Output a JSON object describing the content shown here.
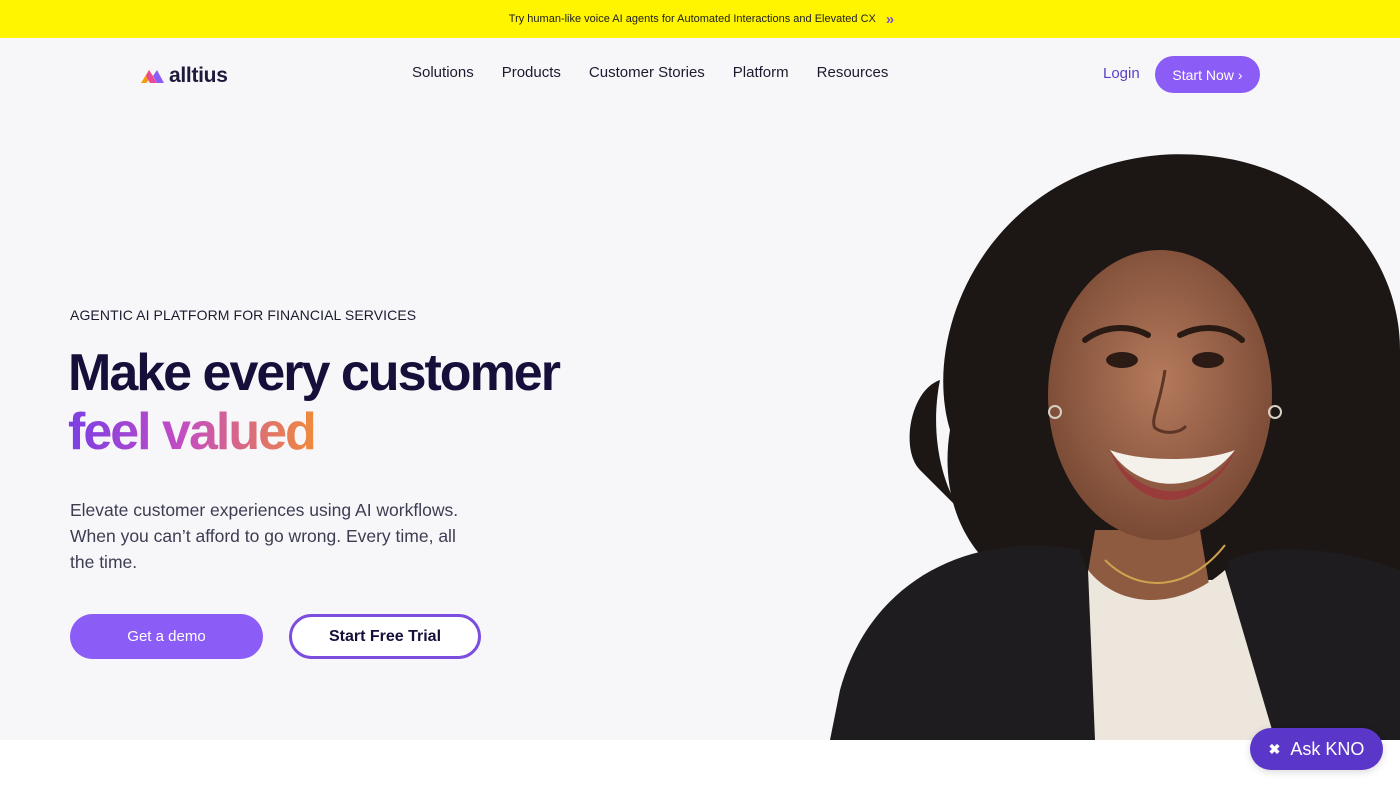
{
  "announcement": {
    "text": "Try human-like voice AI agents for Automated Interactions and Elevated CX",
    "icon": "double-chevron-right-icon",
    "chevron": "»"
  },
  "nav": {
    "logo_text": "alltius",
    "menu": [
      {
        "label": "Solutions"
      },
      {
        "label": "Products"
      },
      {
        "label": "Customer Stories"
      },
      {
        "label": "Platform"
      },
      {
        "label": "Resources"
      }
    ],
    "login": "Login",
    "start_now": "Start Now",
    "start_now_arrow": "›"
  },
  "hero": {
    "eyebrow": "AGENTIC AI PLATFORM FOR FINANCIAL SERVICES",
    "headline_line1": "Make every customer",
    "headline_line2": "feel valued",
    "subtext": "Elevate customer experiences using AI workflows. When you can’t afford to go wrong. Every time, all the time.",
    "cta_primary": "Get a demo",
    "cta_secondary": "Start Free Trial"
  },
  "chat_widget": {
    "label": "Ask KNO",
    "icon": "kno-logo-icon",
    "icon_glyph": "✖"
  },
  "colors": {
    "announce_bg": "#fff500",
    "brand_purple": "#8b5cf6",
    "headline_dark": "#150f3a",
    "gradient": [
      "#7b3fe4",
      "#c24cc4",
      "#f08a3a"
    ]
  }
}
